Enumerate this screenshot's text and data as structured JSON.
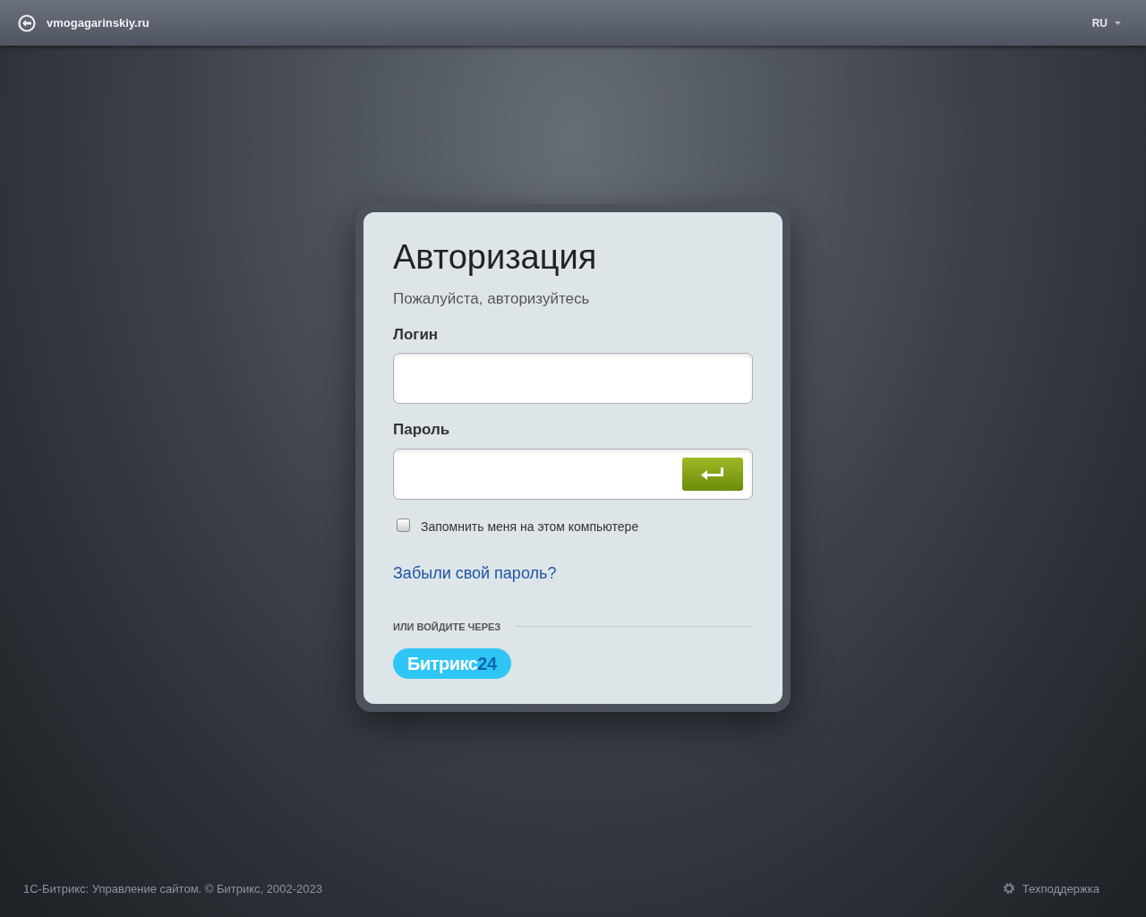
{
  "header": {
    "site": "vmogagarinskiy.ru",
    "language": "RU"
  },
  "form": {
    "title": "Авторизация",
    "subtitle": "Пожалуйста, авторизуйтесь",
    "login_label": "Логин",
    "password_label": "Пароль",
    "remember": {
      "label": "Запомнить меня на этом компьютере",
      "checked": false
    },
    "forgot_link": "Забыли свой пароль?",
    "alt_login_label": "ИЛИ ВОЙДИТЕ ЧЕРЕЗ",
    "bitrix24_button": {
      "text": "Битрикс",
      "number": "24"
    }
  },
  "footer": {
    "copyright": "1С-Битрикс: Управление сайтом. © Битрикс, 2002-2023",
    "support": "Техподдержка"
  }
}
